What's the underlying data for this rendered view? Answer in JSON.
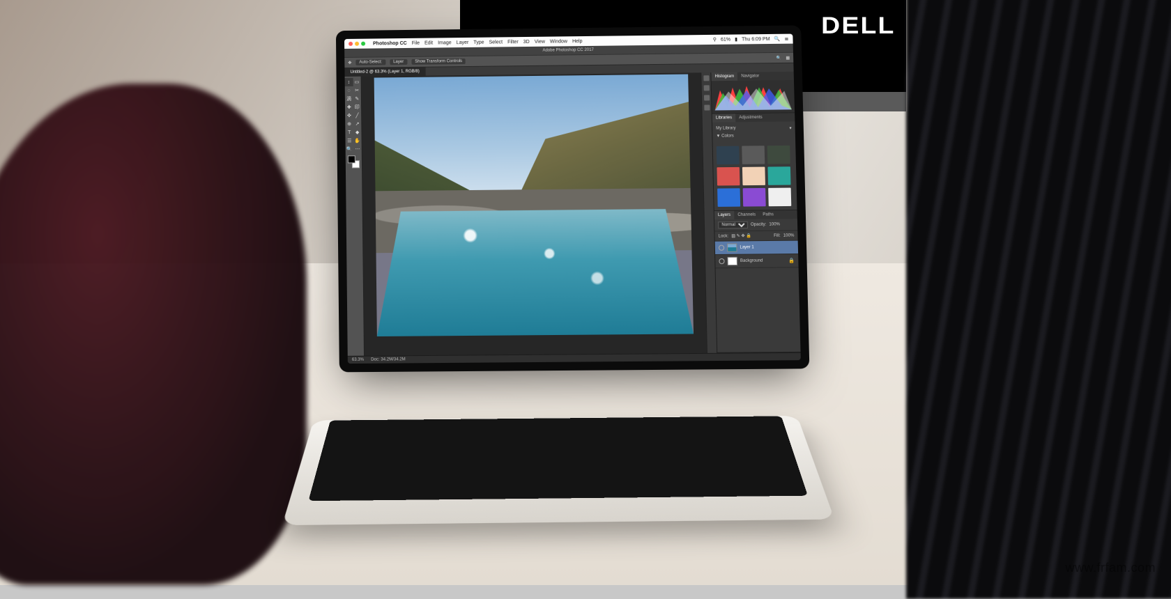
{
  "watermark": "www.frfam.com",
  "monitor_brand": "DELL",
  "mac_menu": {
    "app": "Photoshop CC",
    "items": [
      "File",
      "Edit",
      "Image",
      "Layer",
      "Type",
      "Select",
      "Filter",
      "3D",
      "View",
      "Window",
      "Help"
    ],
    "battery": "61%",
    "clock": "Thu 6:09 PM",
    "user_icon": "◧"
  },
  "app": {
    "title": "Adobe Photoshop CC 2017"
  },
  "options": {
    "tool_label": "Auto-Select:",
    "scope": "Layer",
    "show_transform": "Show Transform Controls"
  },
  "doc_tabs": [
    {
      "label": "Untitled-2 @ 63.3% (Layer 1, RGB/8)",
      "active": true
    }
  ],
  "tools": [
    "↕",
    "▭",
    "◌",
    "✂",
    "✎",
    "✜",
    "滴",
    "✚",
    "╱",
    "印",
    "⊕",
    "T",
    "◆",
    "↗",
    "☰",
    "✋",
    "🔍",
    "⋯"
  ],
  "panels": {
    "histogram": {
      "tabs": [
        "Histogram",
        "Navigator"
      ]
    },
    "libraries": {
      "tabs": [
        "Libraries",
        "Adjustments"
      ],
      "library_name": "My Library",
      "section": "▼ Colors",
      "swatches": [
        "#2f4150",
        "#5a5a5a",
        "#3e4a3e",
        "#d9534f",
        "#f2d2b6",
        "#2aa79b",
        "#2b6fd8",
        "#8a4bd3",
        "#efefef"
      ]
    },
    "layers": {
      "tabs": [
        "Layers",
        "Channels",
        "Paths"
      ],
      "blend": "Normal",
      "opacity_label": "Opacity:",
      "opacity": "100%",
      "fill_label": "Fill:",
      "fill": "100%",
      "lock_label": "Lock:",
      "rows": [
        {
          "name": "Layer 1",
          "active": true,
          "locked": false
        },
        {
          "name": "Background",
          "active": false,
          "locked": true
        }
      ]
    }
  },
  "status": {
    "zoom": "63.3%",
    "doc": "Doc: 34.2M/34.2M"
  }
}
